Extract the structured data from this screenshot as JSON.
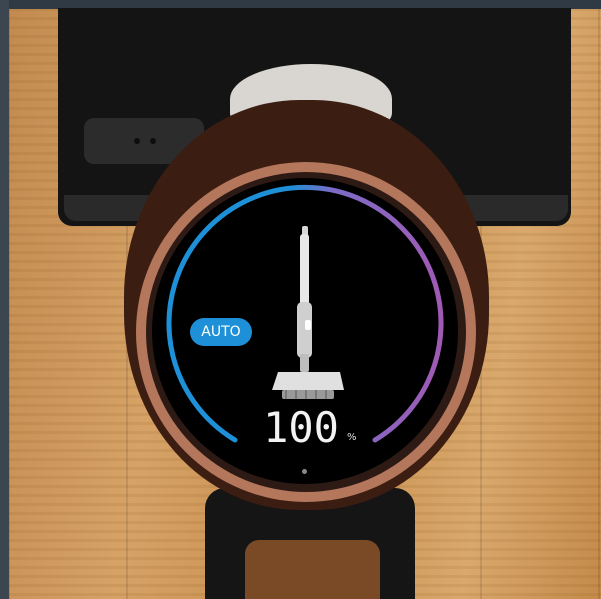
{
  "display": {
    "mode": "AUTO",
    "battery_level": "100",
    "battery_unit": "%",
    "battery_fraction": 1.0
  },
  "colors": {
    "arc_blue": "#1e90d8",
    "arc_purple": "#a05ab4",
    "ring_copper": "#b4775c",
    "floor_wood": "#c8904f"
  },
  "icons": {
    "device": "stick-vacuum-icon"
  }
}
